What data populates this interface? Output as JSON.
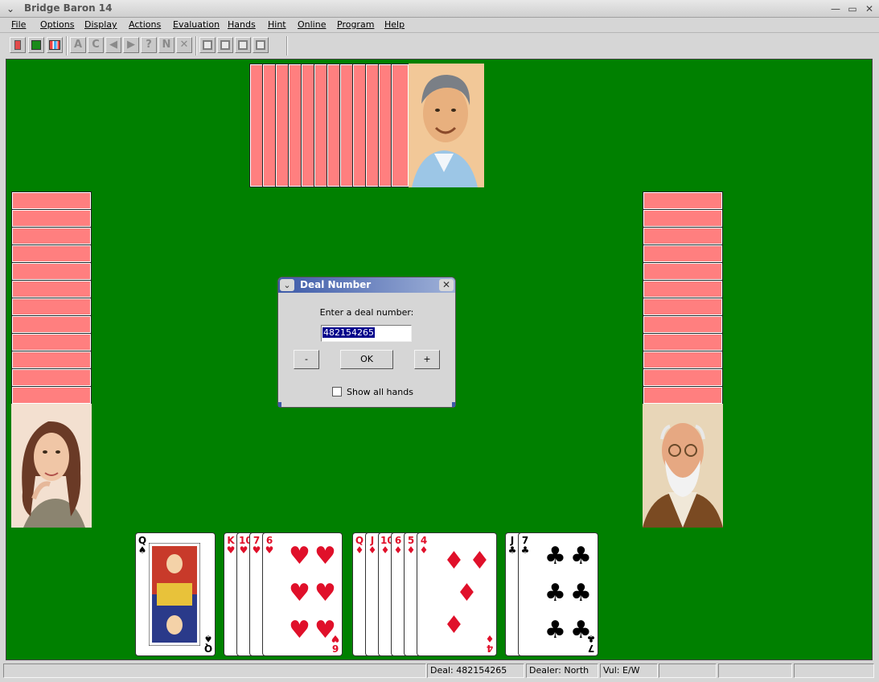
{
  "window": {
    "title": "Bridge Baron 14"
  },
  "menu": [
    "File",
    "Options",
    "Display",
    "Actions",
    "Evaluation",
    "Hands",
    "Hint",
    "Online",
    "Program",
    "Help"
  ],
  "toolbar": {
    "letter_buttons": [
      "A",
      "C",
      "◀",
      "▶",
      "?",
      "N",
      "✕"
    ]
  },
  "north": {
    "card_backs": 12
  },
  "west": {
    "card_backs": 12
  },
  "east": {
    "card_backs": 12
  },
  "south": {
    "hand": [
      {
        "suit": "spades",
        "symbol": "♠",
        "ranks": [
          "Q"
        ]
      },
      {
        "suit": "hearts",
        "symbol": "♥",
        "ranks": [
          "K",
          "10",
          "7",
          "6"
        ]
      },
      {
        "suit": "diamonds",
        "symbol": "♦",
        "ranks": [
          "Q",
          "J",
          "10",
          "6",
          "5",
          "4"
        ]
      },
      {
        "suit": "clubs",
        "symbol": "♣",
        "ranks": [
          "J",
          "7"
        ]
      }
    ]
  },
  "dialog": {
    "title": "Deal Number",
    "prompt": "Enter a deal number:",
    "value": "482154265",
    "minus_label": "-",
    "ok_label": "OK",
    "plus_label": "+",
    "checkbox_label": "Show all hands",
    "checkbox_checked": false
  },
  "statusbar": {
    "deal": "Deal: 482154265",
    "dealer": "Dealer: North",
    "vul": "Vul: E/W"
  },
  "colors": {
    "table": "#008000",
    "card_back": "#ff7f7f",
    "red_suit": "#e0102a",
    "dialog_title": "#3d5aa8"
  }
}
